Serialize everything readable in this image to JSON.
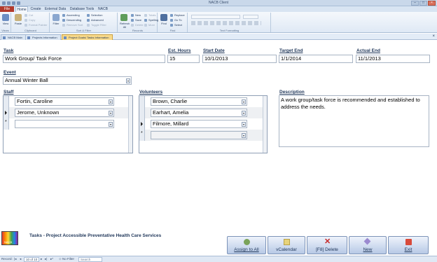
{
  "window": {
    "title": "NACB Client"
  },
  "ribbon_tabs": {
    "file": "File",
    "home": "Home",
    "create": "Create",
    "external_data": "External Data",
    "database_tools": "Database Tools",
    "nacb": "NACB"
  },
  "ribbon": {
    "views": {
      "view": "View",
      "group": "Views"
    },
    "clipboard": {
      "paste": "Paste",
      "cut": "Cut",
      "copy": "Copy",
      "format_painter": "Format Painter",
      "group": "Clipboard"
    },
    "sort_filter": {
      "filter": "Filter",
      "ascending": "Ascending",
      "descending": "Descending",
      "remove_sort": "Remove Sort",
      "selection": "Selection",
      "advanced": "Advanced",
      "toggle_filter": "Toggle Filter",
      "group": "Sort & Filter"
    },
    "records": {
      "refresh": "Refresh All",
      "new": "New",
      "save": "Save",
      "delete": "Delete",
      "totals": "Totals",
      "spelling": "Spelling",
      "more": "More",
      "group": "Records"
    },
    "find": {
      "find": "Find",
      "replace": "Replace",
      "goto": "Go To",
      "select": "Select",
      "group": "Find"
    },
    "text_formatting": {
      "group": "Text Formatting"
    }
  },
  "doc_tabs": {
    "main": "NACB Main",
    "projects": "Projects Information",
    "goals": "Project Goals/ Tasks Information"
  },
  "form": {
    "task_label": "Task",
    "task_value": "Work Group/ Task Force",
    "hours_label": "Est. Hours",
    "hours_value": "15",
    "start_label": "Start Date",
    "start_value": "10/1/2013",
    "target_label": "Target End",
    "target_value": "1/1/2014",
    "actual_label": "Actual End",
    "actual_value": "11/1/2013",
    "event_label": "Event",
    "event_value": "Annual Winter Ball",
    "staff_label": "Staff",
    "staff": [
      "Fortin, Caroline",
      "Jerome, Unknown",
      ""
    ],
    "volunteers_label": "Volunteers",
    "volunteers": [
      "Brown, Charlie",
      "Earhart, Amelia",
      "Filmore, Millard",
      ""
    ],
    "description_label": "Description",
    "description_value": "A work group/task force is recommended and established to address the needs."
  },
  "footer": {
    "logo_text": "NACB",
    "title": "Tasks - Project Accessible Preventative Health Care Services",
    "buttons": {
      "assign": "Assign to All",
      "vcalendar": "vCalendar",
      "delete": "[F8] Delete",
      "new": "New",
      "exit": "Exit"
    }
  },
  "navbar": {
    "record_label": "Record:",
    "record_pos": "10 of 10",
    "filter": "No Filter",
    "search": "Search"
  }
}
